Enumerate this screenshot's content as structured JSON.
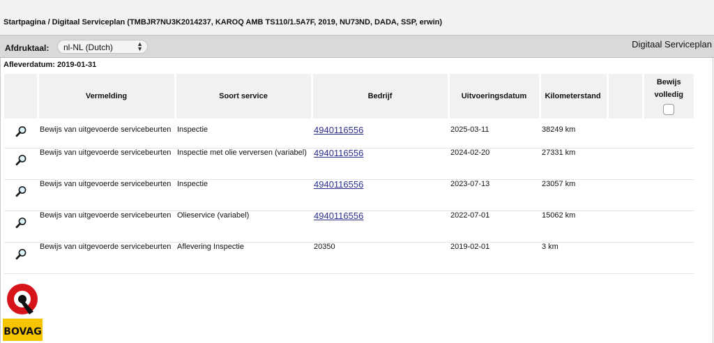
{
  "breadcrumb": "Startpagina / Digitaal Serviceplan (TMBJR7NU3K2014237, KAROQ AMB TS110/1.5A7F, 2019, NU73ND, DADA, SSP, erwin)",
  "toolbar": {
    "print_label": "Afdruktaal:",
    "language_value": "nl-NL (Dutch)",
    "app_title": "Digitaal Serviceplan"
  },
  "delivery_date": "Afleverdatum: 2019-01-31",
  "table": {
    "headers": {
      "vermelding": "Vermelding",
      "soort": "Soort service",
      "bedrijf": "Bedrijf",
      "datum": "Uitvoeringsdatum",
      "km": "Kilometerstand",
      "bewijs": "Bewijs volledig"
    },
    "rows": [
      {
        "vermelding": "Bewijs van uitgevoerde servicebeurten",
        "soort": "Inspectie",
        "bedrijf": "4940116556",
        "datum": "2025-03-11",
        "km": "38249 km"
      },
      {
        "vermelding": "Bewijs van uitgevoerde servicebeurten",
        "soort": "Inspectie met olie verversen (variabel)",
        "bedrijf": "4940116556",
        "datum": "2024-02-20",
        "km": "27331 km"
      },
      {
        "vermelding": "Bewijs van uitgevoerde servicebeurten",
        "soort": "Inspectie",
        "bedrijf": "4940116556",
        "datum": "2023-07-13",
        "km": "23057 km"
      },
      {
        "vermelding": "Bewijs van uitgevoerde servicebeurten",
        "soort": "Olieservice (variabel)",
        "bedrijf": "4940116556",
        "datum": "2022-07-01",
        "km": "15062 km"
      },
      {
        "vermelding": "Bewijs van uitgevoerde servicebeurten",
        "soort": "Aflevering Inspectie",
        "bedrijf": "20350",
        "datum": "2019-02-01",
        "km": "3 km"
      }
    ]
  },
  "logo": {
    "text": "BOVAG",
    "colors": {
      "red": "#d7141a",
      "yellow": "#f6c500",
      "black": "#111111"
    }
  },
  "icons": {
    "row_icon": "magnifier-icon",
    "select_icon": "chevron-updown-icon"
  }
}
